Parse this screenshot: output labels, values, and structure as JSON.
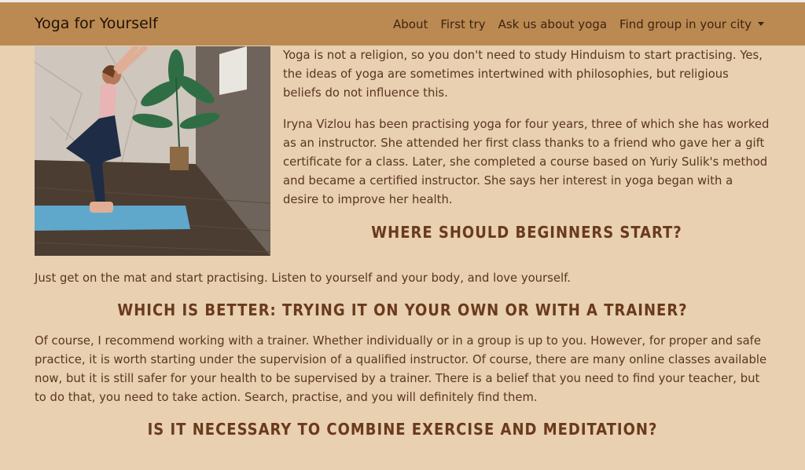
{
  "navbar": {
    "brand": "Yoga for Yourself",
    "links": [
      "About",
      "First try",
      "Ask us about yoga",
      "Find group in your city"
    ]
  },
  "article": {
    "p1": "Yoga is not a religion, so you don't need to study Hinduism to start practising. Yes, the ideas of yoga are sometimes intertwined with philosophies, but religious beliefs do not influence this.",
    "p2": "Iryna Vizlou has been practising yoga for four years, three of which she has worked as an instructor. She attended her first class thanks to a friend who gave her a gift certificate for a class. Later, she completed a course based on Yuriy Sulik's method and became a certified instructor. She says her interest in yoga began with a desire to improve her health.",
    "h1": "Where should beginners start?",
    "p3": "Just get on the mat and start practising. Listen to yourself and your body, and love yourself.",
    "h2": "Which is better: trying it on your own or with a trainer?",
    "p4": "Of course, I recommend working with a trainer. Whether individually or in a group is up to you. However, for proper and safe practice, it is worth starting under the supervision of a qualified instructor. Of course, there are many online classes available now, but it is still safer for your health to be supervised by a trainer. There is a belief that you need to find your teacher, but to do that, you need to take action. Search, practise, and you will definitely find them.",
    "h3": "Is it necessary to combine exercise and meditation?"
  },
  "colors": {
    "navbar_bg": "#bb8a52",
    "page_bg": "#e8d0b1",
    "heading": "#6a3a1c",
    "text": "#5a3520"
  },
  "icons": {
    "dropdown": "caret-down-icon"
  }
}
